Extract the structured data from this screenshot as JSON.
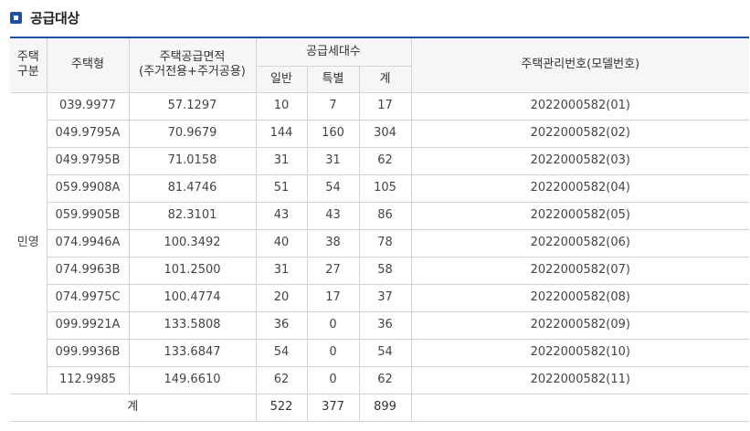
{
  "section": {
    "title": "공급대상"
  },
  "table": {
    "headers": {
      "housing_category_line1": "주택",
      "housing_category_line2": "구분",
      "housing_type": "주택형",
      "supply_area_line1": "주택공급면적",
      "supply_area_line2": "(주거전용+주거공용)",
      "supply_units": "공급세대수",
      "general": "일반",
      "special": "특별",
      "total": "계",
      "management_number": "주택관리번호(모델번호)"
    },
    "category": "민영",
    "rows": [
      {
        "type": "039.9977",
        "area": "57.1297",
        "general": "10",
        "special": "7",
        "total": "17",
        "mgmt": "2022000582(01)"
      },
      {
        "type": "049.9795A",
        "area": "70.9679",
        "general": "144",
        "special": "160",
        "total": "304",
        "mgmt": "2022000582(02)"
      },
      {
        "type": "049.9795B",
        "area": "71.0158",
        "general": "31",
        "special": "31",
        "total": "62",
        "mgmt": "2022000582(03)"
      },
      {
        "type": "059.9908A",
        "area": "81.4746",
        "general": "51",
        "special": "54",
        "total": "105",
        "mgmt": "2022000582(04)"
      },
      {
        "type": "059.9905B",
        "area": "82.3101",
        "general": "43",
        "special": "43",
        "total": "86",
        "mgmt": "2022000582(05)"
      },
      {
        "type": "074.9946A",
        "area": "100.3492",
        "general": "40",
        "special": "38",
        "total": "78",
        "mgmt": "2022000582(06)"
      },
      {
        "type": "074.9963B",
        "area": "101.2500",
        "general": "31",
        "special": "27",
        "total": "58",
        "mgmt": "2022000582(07)"
      },
      {
        "type": "074.9975C",
        "area": "100.4774",
        "general": "20",
        "special": "17",
        "total": "37",
        "mgmt": "2022000582(08)"
      },
      {
        "type": "099.9921A",
        "area": "133.5808",
        "general": "36",
        "special": "0",
        "total": "36",
        "mgmt": "2022000582(09)"
      },
      {
        "type": "099.9936B",
        "area": "133.6847",
        "general": "54",
        "special": "0",
        "total": "54",
        "mgmt": "2022000582(10)"
      },
      {
        "type": "112.9985",
        "area": "149.6610",
        "general": "62",
        "special": "0",
        "total": "62",
        "mgmt": "2022000582(11)"
      }
    ],
    "totals": {
      "label": "계",
      "general": "522",
      "special": "377",
      "total": "899"
    }
  },
  "colors": {
    "accent": "#1f4fa8",
    "header_bg": "#f5f6f8",
    "border": "#d4d4d4"
  },
  "icons": {
    "section": "square-bullet-icon"
  }
}
